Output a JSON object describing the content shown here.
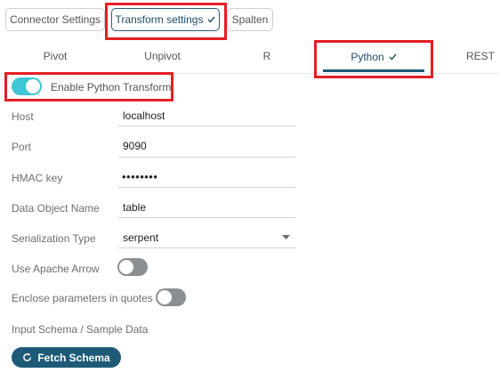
{
  "top_tabs": [
    {
      "label": "Connector Settings",
      "active": false
    },
    {
      "label": "Transform settings",
      "active": true
    },
    {
      "label": "Spalten",
      "active": false
    }
  ],
  "sub_tabs": [
    {
      "label": "Pivot",
      "active": false
    },
    {
      "label": "Unpivot",
      "active": false
    },
    {
      "label": "R",
      "active": false
    },
    {
      "label": "Python",
      "active": true
    },
    {
      "label": "REST",
      "active": false
    }
  ],
  "enable_toggle": {
    "label": "Enable Python Transform",
    "on": true
  },
  "fields": {
    "host": {
      "label": "Host",
      "value": "localhost"
    },
    "port": {
      "label": "Port",
      "value": "9090"
    },
    "hmac": {
      "label": "HMAC key",
      "value": "••••••••"
    },
    "data_object": {
      "label": "Data Object Name",
      "value": "table"
    },
    "serialization": {
      "label": "Serialization Type",
      "value": "serpent"
    }
  },
  "use_arrow": {
    "label": "Use Apache Arrow",
    "on": false
  },
  "enclose": {
    "label": "Enclose parameters in quotes",
    "on": false
  },
  "input_schema_label": "Input Schema / Sample Data",
  "fetch_button": {
    "label": "Fetch Schema"
  },
  "colors": {
    "accent": "#1d5a78",
    "toggle_on": "#3ec6d4",
    "highlight": "#e41f24"
  }
}
